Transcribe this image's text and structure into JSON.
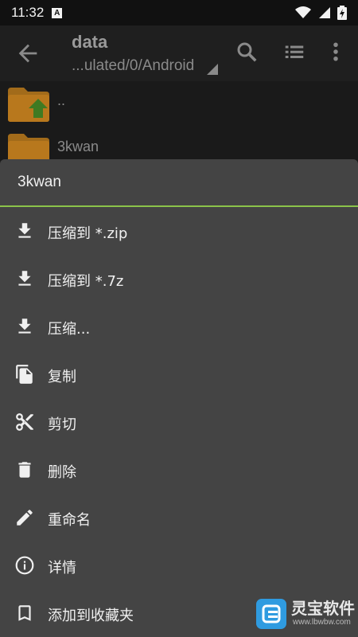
{
  "status_bar": {
    "time": "11:32",
    "notif_badge": "A"
  },
  "toolbar": {
    "title": "data",
    "path": "...ulated/0/Android"
  },
  "files": [
    {
      "name": ".."
    },
    {
      "name": "3kwan"
    }
  ],
  "sheet": {
    "title": "3kwan",
    "items": [
      {
        "label": "压缩到 *.zip",
        "icon": "download-icon"
      },
      {
        "label": "压缩到 *.7z",
        "icon": "download-icon"
      },
      {
        "label": "压缩...",
        "icon": "download-icon"
      },
      {
        "label": "复制",
        "icon": "copy-icon"
      },
      {
        "label": "剪切",
        "icon": "scissors-icon"
      },
      {
        "label": "删除",
        "icon": "trash-icon"
      },
      {
        "label": "重命名",
        "icon": "pencil-icon"
      },
      {
        "label": "详情",
        "icon": "info-icon"
      },
      {
        "label": "添加到收藏夹",
        "icon": "bookmark-icon"
      }
    ]
  },
  "watermark": {
    "text": "灵宝软件",
    "url": "www.lbwbw.com"
  },
  "colors": {
    "accent": "#8bc34a",
    "folder": "#e39a2c",
    "sheet_bg": "#444444"
  }
}
